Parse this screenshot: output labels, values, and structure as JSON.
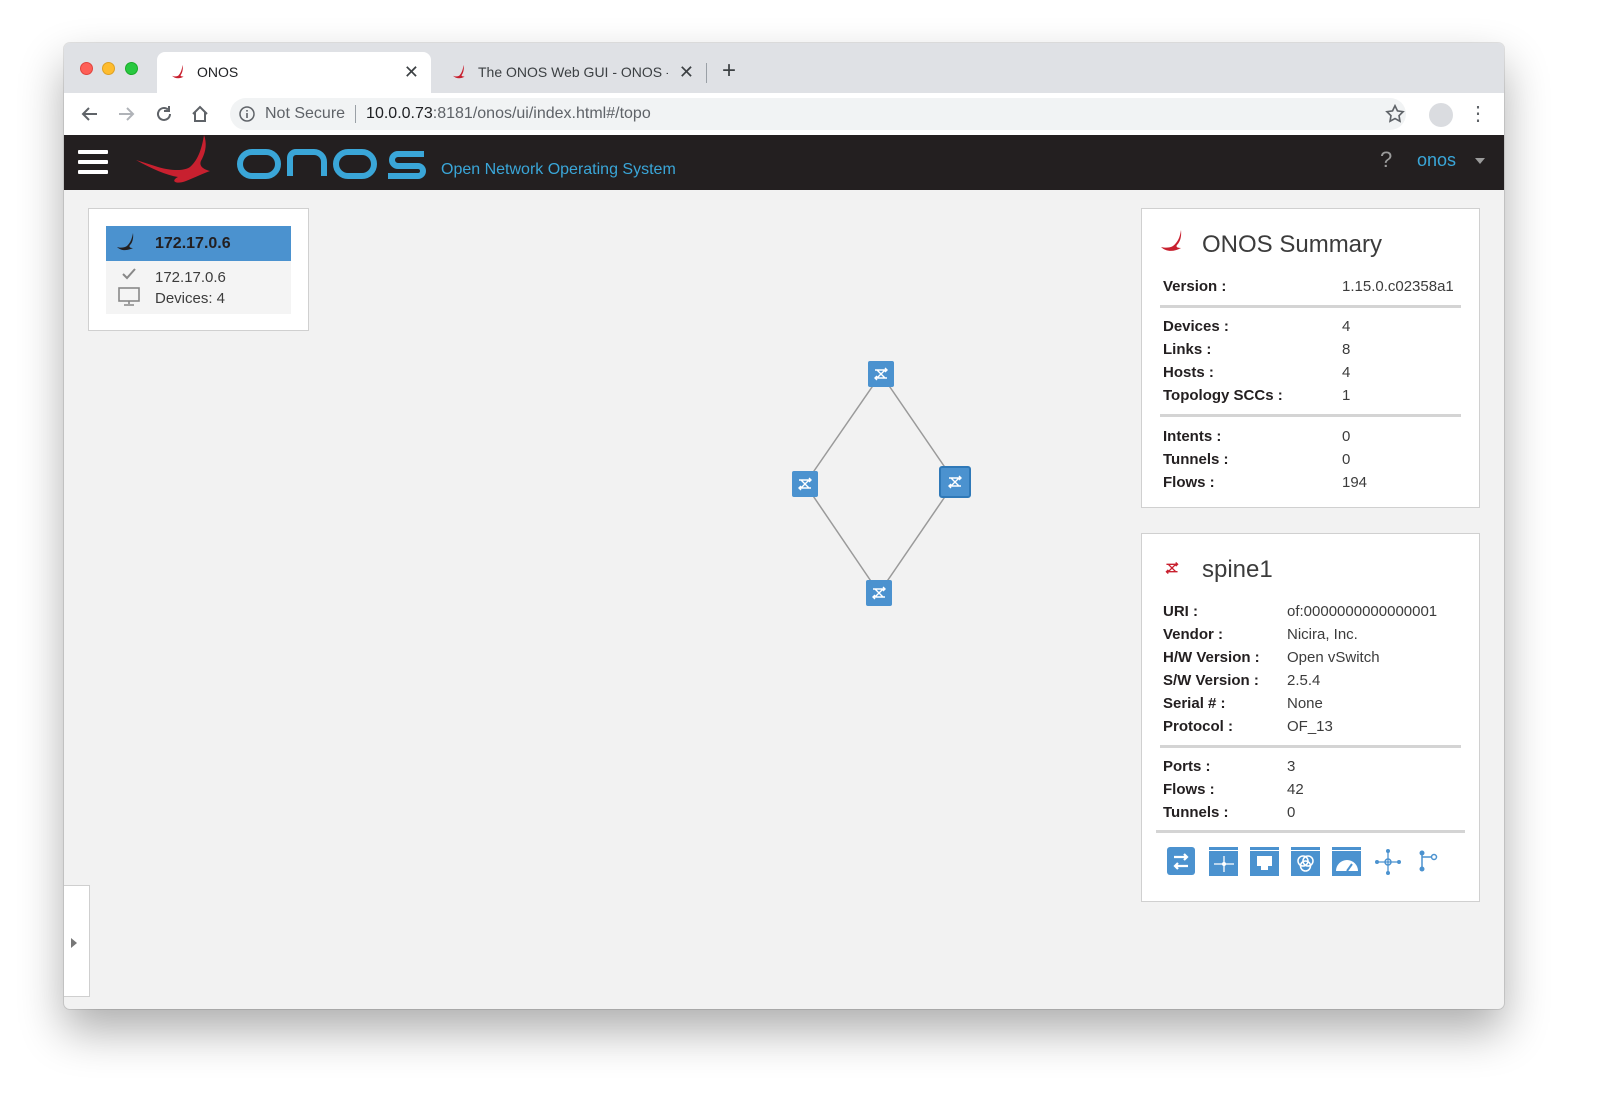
{
  "browser": {
    "tabs": [
      {
        "title": "ONOS",
        "active": true
      },
      {
        "title": "The ONOS Web GUI - ONOS - ",
        "active": false
      }
    ],
    "security_label": "Not Secure",
    "url_host": "10.0.0.73",
    "url_path": ":8181/onos/ui/index.html#/topo"
  },
  "header": {
    "tagline": "Open Network Operating System",
    "help": "?",
    "user": "onos",
    "accent_color": "#3aa6d8",
    "brand_red": "#c8202f"
  },
  "instance": {
    "title": "172.17.0.6",
    "line1": "172.17.0.6",
    "line2": "Devices: 4"
  },
  "summary": {
    "title": "ONOS Summary",
    "version_label": "Version :",
    "version": "1.15.0.c02358a1",
    "group1": [
      {
        "k": "Devices :",
        "v": "4"
      },
      {
        "k": "Links :",
        "v": "8"
      },
      {
        "k": "Hosts :",
        "v": "4"
      },
      {
        "k": "Topology SCCs :",
        "v": "1"
      }
    ],
    "group2": [
      {
        "k": "Intents :",
        "v": "0"
      },
      {
        "k": "Tunnels :",
        "v": "0"
      },
      {
        "k": "Flows :",
        "v": "194"
      }
    ]
  },
  "device": {
    "title": "spine1",
    "props": [
      {
        "k": "URI :",
        "v": "of:0000000000000001"
      },
      {
        "k": "Vendor :",
        "v": "Nicira, Inc."
      },
      {
        "k": "H/W Version :",
        "v": "Open vSwitch"
      },
      {
        "k": "S/W Version :",
        "v": "2.5.4"
      },
      {
        "k": "Serial # :",
        "v": "None"
      },
      {
        "k": "Protocol :",
        "v": "OF_13"
      }
    ],
    "stats": [
      {
        "k": "Ports :",
        "v": "3"
      },
      {
        "k": "Flows :",
        "v": "42"
      },
      {
        "k": "Tunnels :",
        "v": "0"
      }
    ],
    "buttons": [
      "show-devices-icon",
      "show-flows-icon",
      "show-ports-icon",
      "show-groups-icon",
      "show-meters-icon",
      "show-pipeconf-icon",
      "show-path-icon"
    ]
  }
}
